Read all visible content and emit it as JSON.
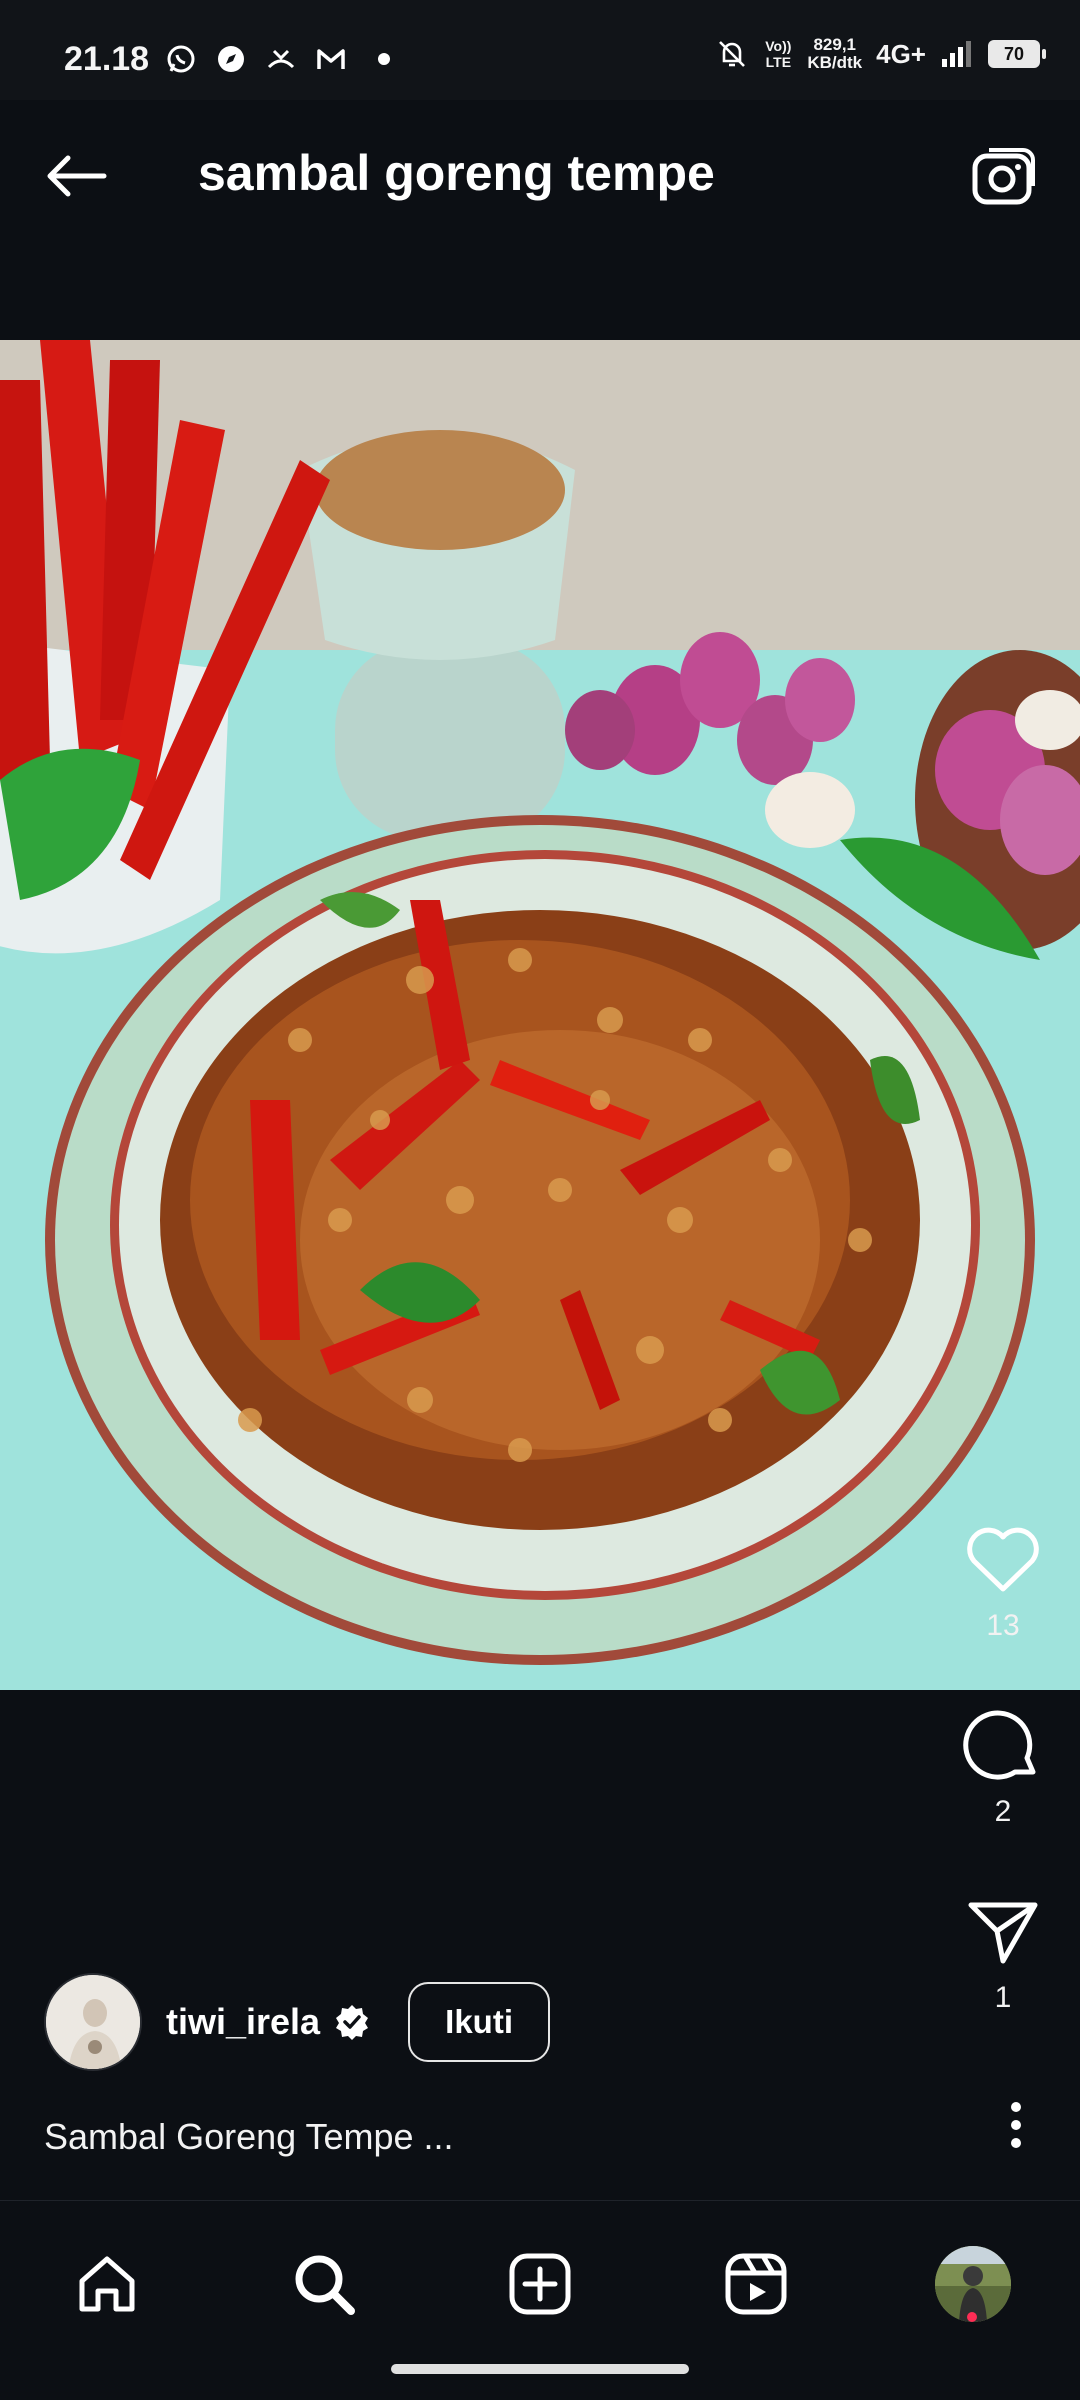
{
  "status_bar": {
    "time": "21.18",
    "volte_label": "Vo)) LTE",
    "speed_value": "829,1",
    "speed_unit": "KB/dtk",
    "network_type": "4G+",
    "battery": "70"
  },
  "header": {
    "title": "sambal goreng tempe"
  },
  "post": {
    "image_alt": "Sambal goreng tempe dish with chilies, shallots and garlic",
    "likes": "13",
    "comments": "2",
    "shares": "1",
    "author": "tiwi_irela",
    "follow_label": "Ikuti",
    "caption": "Sambal Goreng Tempe ..."
  },
  "nav": {
    "items": [
      "home",
      "search",
      "create",
      "reels",
      "profile"
    ]
  },
  "colors": {
    "background": "#0c0f14",
    "accent_notification": "#ff2d55",
    "verified_badge": "#ffffff"
  }
}
